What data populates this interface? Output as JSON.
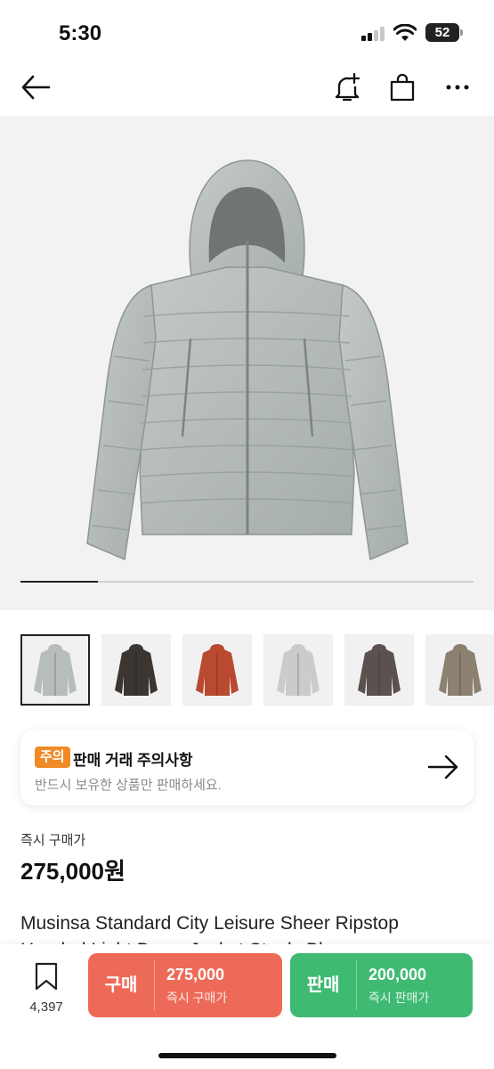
{
  "status_bar": {
    "time": "5:30",
    "battery": "52"
  },
  "nav": {
    "icons": [
      "back-arrow-icon",
      "alarm-add-icon",
      "shopping-bag-icon",
      "more-icon"
    ]
  },
  "hero": {
    "image_progress": 0.17,
    "image": "grey hooded puffer jacket"
  },
  "thumbnails": [
    {
      "color": "#b7bdb9",
      "selected": true
    },
    {
      "color": "#3b3631",
      "selected": false
    },
    {
      "color": "#b9492f",
      "selected": false
    },
    {
      "color": "#c9cbcc",
      "selected": false
    },
    {
      "color": "#5b5250",
      "selected": false
    },
    {
      "color": "#8c8171",
      "selected": false
    }
  ],
  "notice": {
    "badge": "주의",
    "title": "판매 거래 주의사항",
    "subtitle": "반드시 보유한 상품만 판매하세요."
  },
  "price": {
    "label": "즉시 구매가",
    "value": "275,000원"
  },
  "product": {
    "title_line1": "Musinsa Standard City Leisure Sheer Ripstop",
    "title_line2": "Hooded Light Down Jacket Steely Blue"
  },
  "bottom_bar": {
    "wish_count": "4,397",
    "buy": {
      "label": "구매",
      "price": "275,000",
      "sub": "즉시 구매가",
      "color": "#ee6a58"
    },
    "sell": {
      "label": "판매",
      "price": "200,000",
      "sub": "즉시 판매가",
      "color": "#3fba73"
    }
  }
}
